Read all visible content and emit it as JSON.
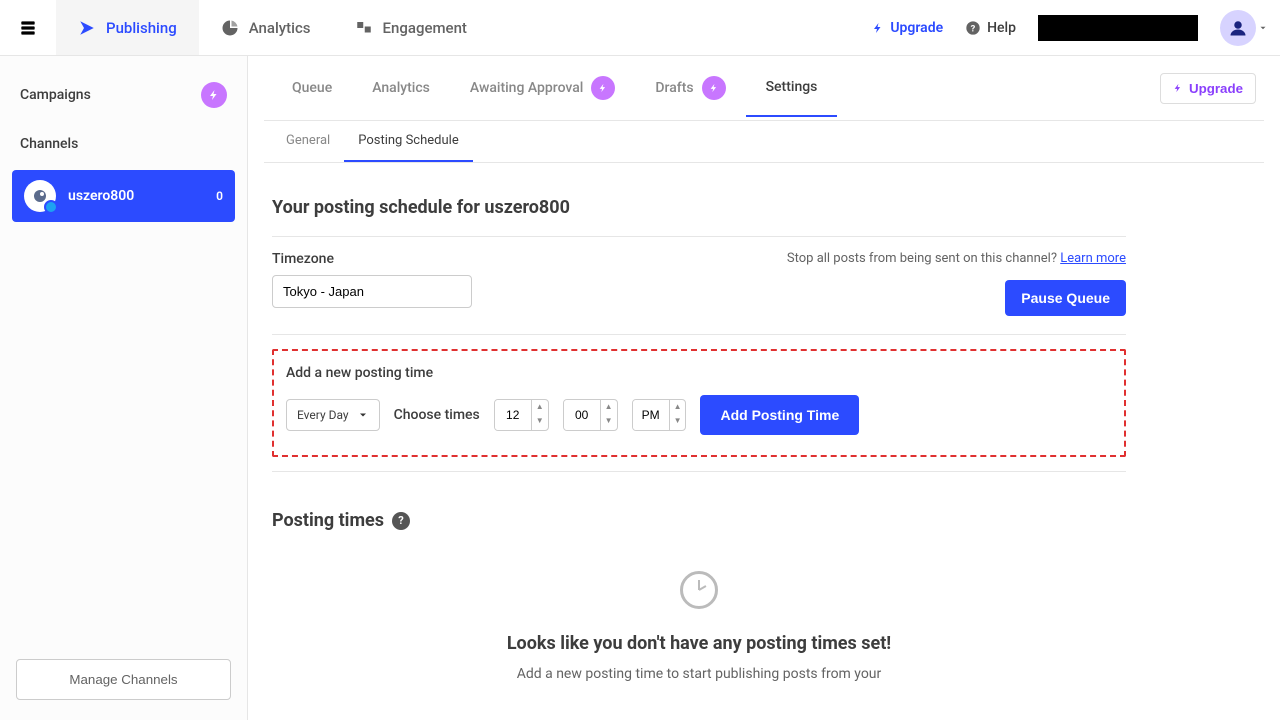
{
  "topnav": {
    "tabs": [
      {
        "label": "Publishing"
      },
      {
        "label": "Analytics"
      },
      {
        "label": "Engagement"
      }
    ],
    "upgrade": "Upgrade",
    "help": "Help"
  },
  "sidebar": {
    "campaigns": "Campaigns",
    "channels": "Channels",
    "channel": {
      "name": "uszero800",
      "count": "0"
    },
    "manage": "Manage Channels"
  },
  "subtabs": {
    "queue": "Queue",
    "analytics": "Analytics",
    "awaiting": "Awaiting Approval",
    "drafts": "Drafts",
    "settings": "Settings",
    "upgrade": "Upgrade"
  },
  "sectabs": {
    "general": "General",
    "schedule": "Posting Schedule"
  },
  "page": {
    "title": "Your posting schedule for uszero800",
    "tz_label": "Timezone",
    "tz_value": "Tokyo - Japan",
    "stop_text": "Stop all posts from being sent on this channel? ",
    "learn_more": "Learn more",
    "pause": "Pause Queue",
    "add_label": "Add a new posting time",
    "day": "Every Day",
    "choose": "Choose times",
    "hour": "12",
    "minute": "00",
    "ampm": "PM",
    "add_btn": "Add Posting Time",
    "pt_title": "Posting times",
    "empty_title": "Looks like you don't have any posting times set!",
    "empty_sub": "Add a new posting time to start publishing posts from your"
  }
}
